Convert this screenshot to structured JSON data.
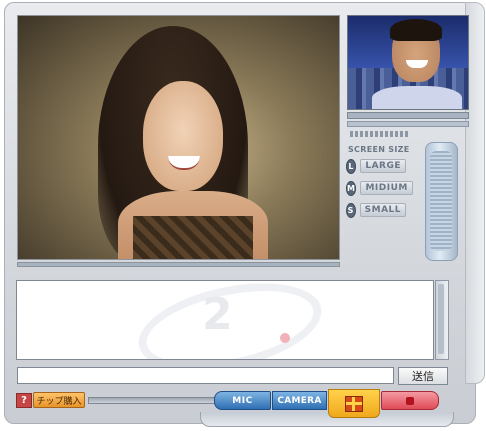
{
  "screen_size": {
    "label": "SCREEN SIZE",
    "options": [
      {
        "key": "L",
        "label": "LARGE"
      },
      {
        "key": "M",
        "label": "MIDIUM"
      },
      {
        "key": "S",
        "label": "SMALL"
      }
    ]
  },
  "chat": {
    "logo_text": "2",
    "input_value": "",
    "send_label": "送信"
  },
  "toolbar": {
    "help_label": "?",
    "chip_label": "チップ購入",
    "mic_label": "MIC",
    "camera_label": "CAMERA"
  },
  "icons": {
    "gift": "gift-icon",
    "stop": "stop-icon",
    "help": "help-icon"
  },
  "colors": {
    "accent_blue": "#2f6fb3",
    "gift_orange": "#f0a81c",
    "stop_red": "#e04b57",
    "chip_orange": "#e8942a"
  }
}
